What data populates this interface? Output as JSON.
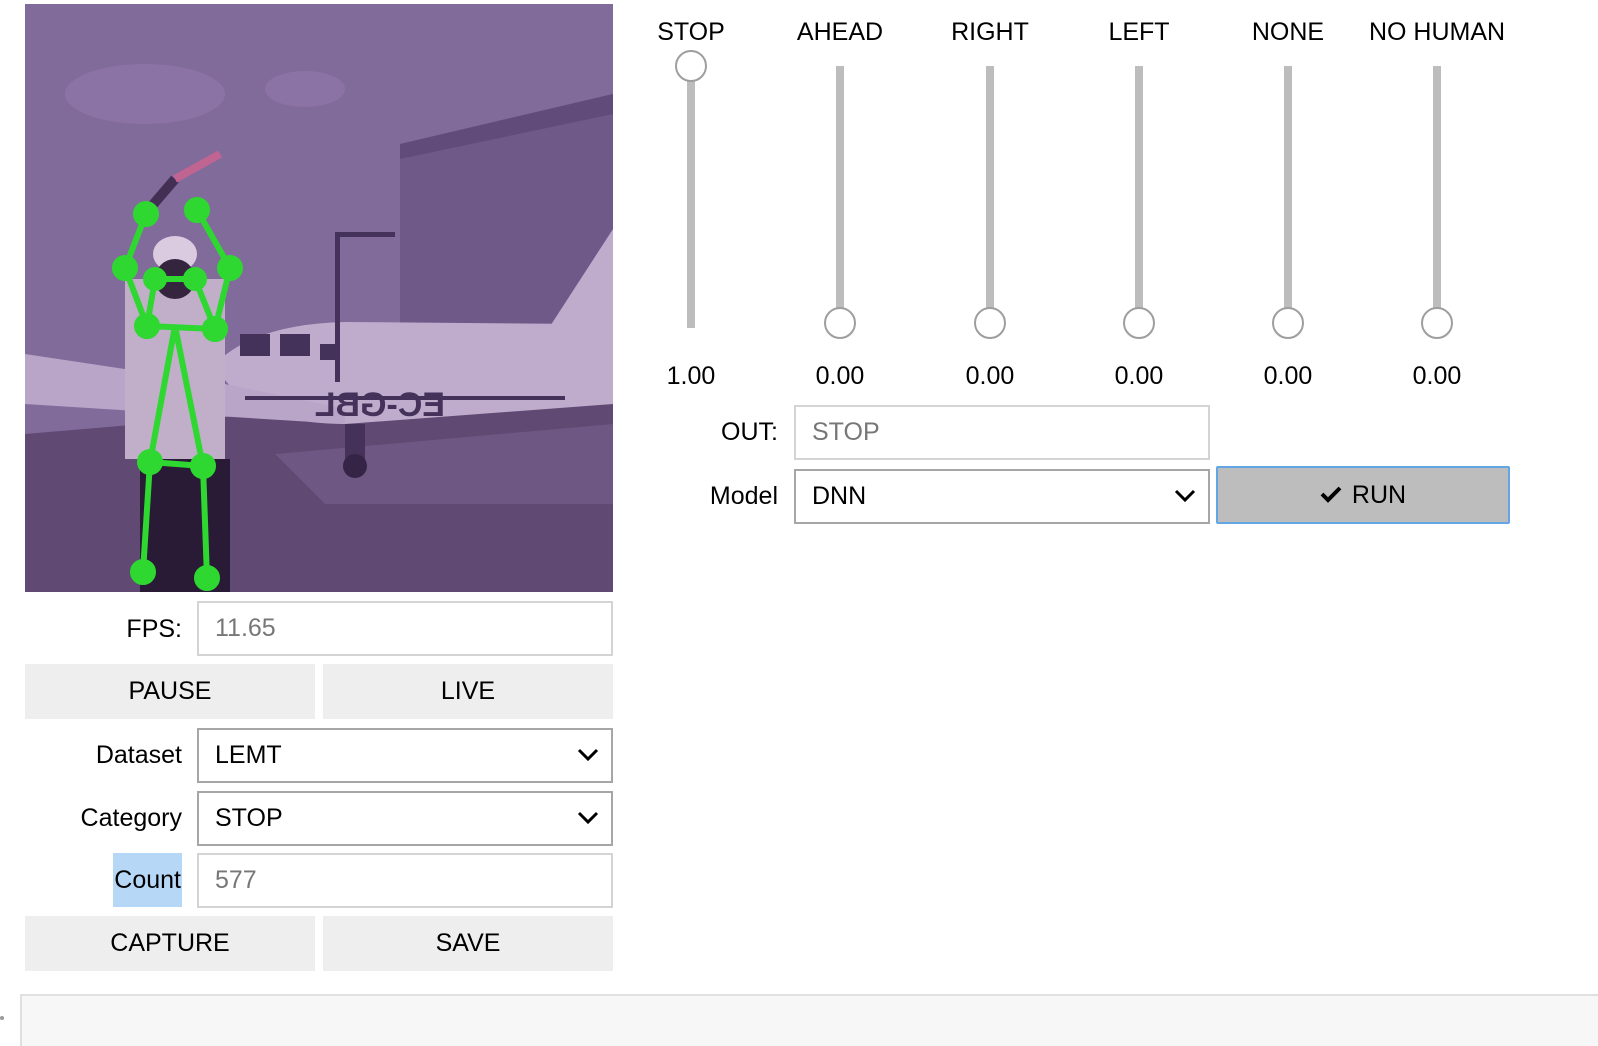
{
  "camera": {
    "plane_registration": "EC-GBL"
  },
  "fps": {
    "label": "FPS:",
    "value": "11.65"
  },
  "buttons": {
    "pause": "PAUSE",
    "live": "LIVE",
    "capture": "CAPTURE",
    "save": "SAVE"
  },
  "dataset": {
    "label": "Dataset",
    "value": "LEMT"
  },
  "category": {
    "label": "Category",
    "value": "STOP"
  },
  "count": {
    "label": "Count",
    "value": "577"
  },
  "sliders": [
    {
      "name": "STOP",
      "value": "1.00",
      "level": 1.0
    },
    {
      "name": "AHEAD",
      "value": "0.00",
      "level": 0.0
    },
    {
      "name": "RIGHT",
      "value": "0.00",
      "level": 0.0
    },
    {
      "name": "LEFT",
      "value": "0.00",
      "level": 0.0
    },
    {
      "name": "NONE",
      "value": "0.00",
      "level": 0.0
    },
    {
      "name": "NO HUMAN",
      "value": "0.00",
      "level": 0.0
    }
  ],
  "out": {
    "label": "OUT:",
    "value": "STOP"
  },
  "model": {
    "label": "Model",
    "value": "DNN"
  },
  "run": {
    "label": "RUN",
    "icon": "checkmark-icon"
  },
  "colors": {
    "skeleton": "#22ee22",
    "run_bg": "#bdbdbd",
    "run_border": "#64a5e4",
    "highlight": "#b7d7f7"
  }
}
